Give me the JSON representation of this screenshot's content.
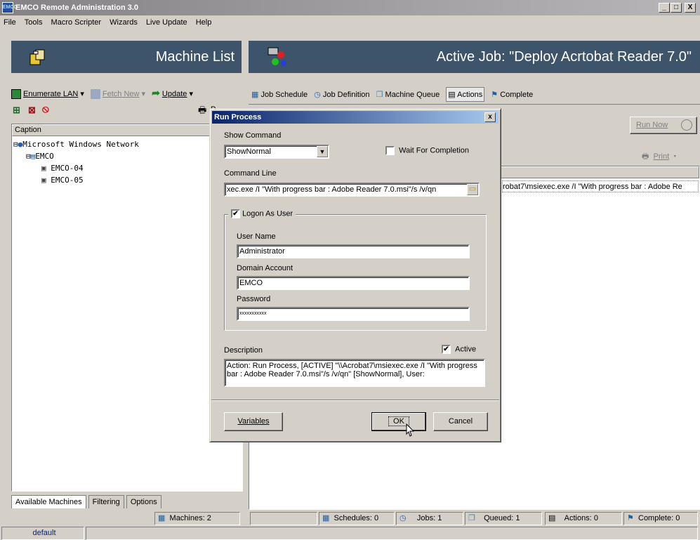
{
  "window": {
    "title": "EMCO Remote Administration 3.0",
    "min": "_",
    "max": "□",
    "close": "X"
  },
  "menu": [
    "File",
    "Tools",
    "Macro Scripter",
    "Wizards",
    "Live Update",
    "Help"
  ],
  "left": {
    "header_title": "Machine List",
    "toolbar": {
      "enumerate": "Enumerate LAN",
      "fetch": "Fetch New",
      "update": "Update",
      "print_partial": "P"
    },
    "column_caption": "Caption",
    "tree": {
      "root": "Microsoft Windows Network",
      "domain": "EMCO",
      "machines": [
        "EMCO-04",
        "EMCO-05"
      ]
    },
    "tabs": [
      "Available Machines",
      "Filtering",
      "Options"
    ],
    "machines_count": "Machines: 2",
    "status_left": "default"
  },
  "right": {
    "header_title": "Active Job: \"Deploy Acrtobat Reader 7.0\"",
    "tabs": [
      "Job Schedule",
      "Job Definition",
      "Machine Queue",
      "Actions",
      "Complete"
    ],
    "run_now": "Run Now",
    "print": "Print",
    "action_row": "robat7\\msiexec.exe /I \"With progress bar : Adobe Re",
    "status": {
      "schedules": "Schedules: 0",
      "jobs": "Jobs: 1",
      "queued": "Queued: 1",
      "actions": "Actions: 0",
      "complete": "Complete: 0"
    }
  },
  "dialog": {
    "title": "Run Process",
    "close": "x",
    "show_command_label": "Show Command",
    "show_command_value": "ShowNormal",
    "wait_label": "Wait For Completion",
    "command_line_label": "Command Line",
    "command_line_value": "xec.exe /I \"With progress bar : Adobe Reader 7.0.msi\"/s /v/qn",
    "logon_label": "Logon As User",
    "user_name_label": "User Name",
    "user_name_value": "Administrator",
    "domain_label": "Domain Account",
    "domain_value": "EMCO",
    "password_label": "Password",
    "password_value": "xxxxxxxxxxx",
    "description_label": "Description",
    "active_label": "Active",
    "description_value": "Action: Run Process, [ACTIVE] \"\\\\Acrobat7\\msiexec.exe /I \"With progress bar : Adobe Reader 7.0.msi\"/s /v/qn\" [ShowNormal], User:",
    "variables_btn": "Variables",
    "ok_btn": "OK",
    "cancel_btn": "Cancel"
  },
  "colors": {
    "header_bg": "#3e546b",
    "title_active": "#0a246a",
    "title_inactive": "#848284"
  }
}
